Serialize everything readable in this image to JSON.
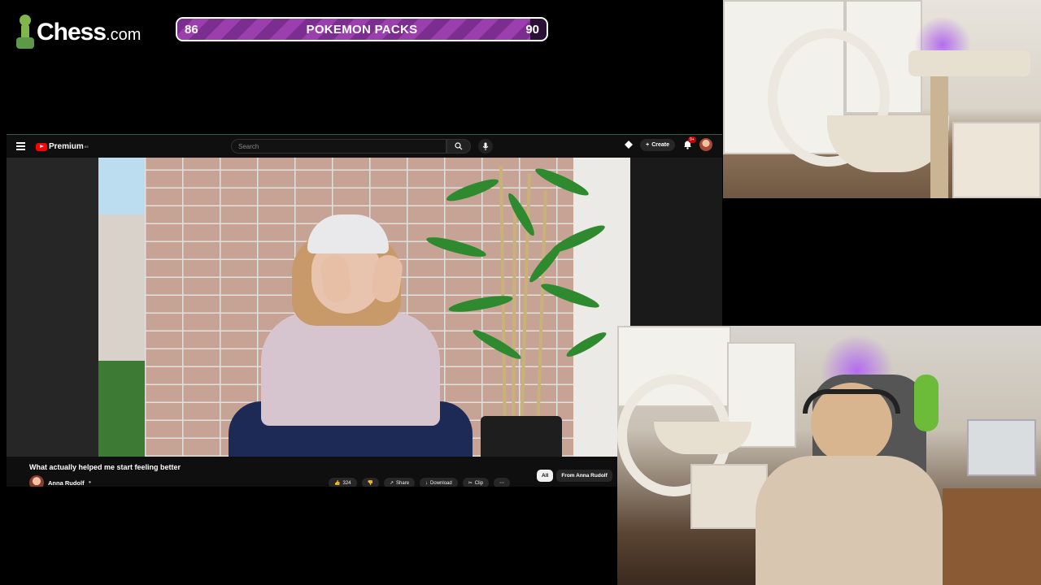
{
  "overlay": {
    "logo_text": "Chess",
    "logo_domain": ".com",
    "goal": {
      "current": "86",
      "label": "POKEMON PACKS",
      "target": "90",
      "progress": 0.955,
      "color": "#8a35a0"
    }
  },
  "youtube": {
    "brand": "Premium",
    "brand_sup": "BE",
    "search": {
      "placeholder": "Search",
      "value": ""
    },
    "create_label": "Create",
    "notifications_badge": "9+",
    "video": {
      "title": "What actually helped me start feeling better",
      "channel": "Anna Rudolf",
      "likes": "324"
    },
    "actions": [
      "Share",
      "Download",
      "Clip"
    ],
    "chips": [
      "All",
      "From Anna Rudolf"
    ]
  },
  "icons": [
    "menu-icon",
    "youtube-logo-icon",
    "search-icon",
    "mic-icon",
    "gems-icon",
    "plus-icon",
    "bell-icon",
    "like-icon",
    "dislike-icon",
    "share-icon",
    "download-icon",
    "clip-icon",
    "more-icon",
    "verified-icon"
  ]
}
